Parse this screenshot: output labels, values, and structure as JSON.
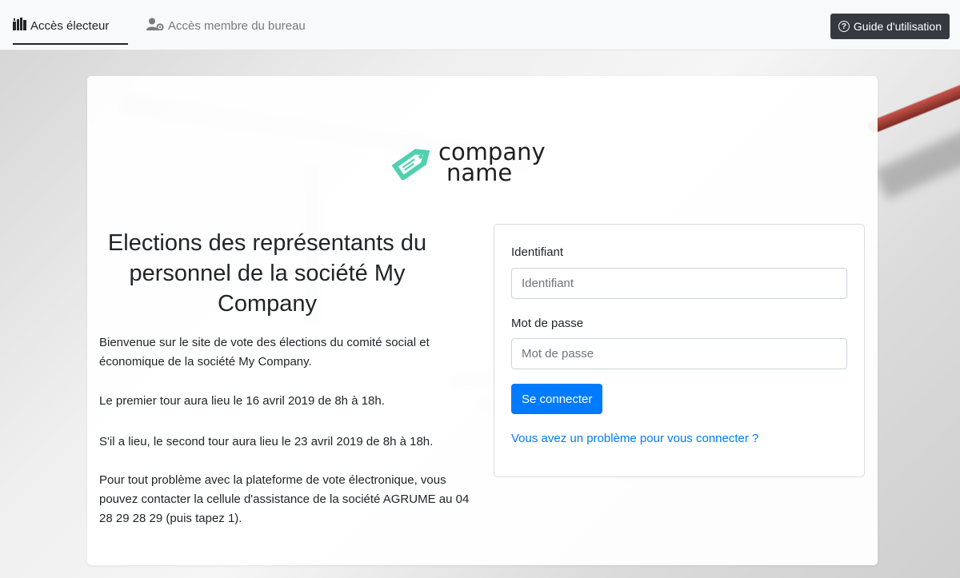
{
  "nav": {
    "voter_tab": "Accès électeur",
    "member_tab": "Accès membre du bureau",
    "guide_button": "Guide d'utilisation"
  },
  "logo": {
    "line1": "company",
    "line2": "name",
    "color": "#4fd1b0"
  },
  "content": {
    "title": "Elections des représentants du personnel de la société My Company",
    "welcome": "Bienvenue sur le site de vote des élections du comité social et économique de la société My Company.",
    "first_round": "Le premier tour aura lieu le 16 avril 2019 de 8h à 18h.",
    "second_round": "S'il a lieu, le second tour aura lieu le 23 avril 2019 de 8h à 18h.",
    "support": "Pour tout problème avec la plateforme de vote électronique, vous pouvez contacter la cellule d'assistance de la société AGRUME au 04 28 29 28 29 (puis tapez 1)."
  },
  "login": {
    "id_label": "Identifiant",
    "id_placeholder": "Identifiant",
    "id_value": "",
    "password_label": "Mot de passe",
    "password_placeholder": "Mot de passe",
    "password_value": "",
    "submit_label": "Se connecter",
    "help_link": "Vous avez un problème pour vous connecter ?"
  },
  "colors": {
    "primary": "#007bff",
    "dark_button": "#343a40",
    "logo_accent": "#4fd1b0"
  },
  "icons": {
    "voter_tab": "ballot-box-icon",
    "member_tab": "user-gear-icon",
    "guide": "question-circle-icon"
  }
}
